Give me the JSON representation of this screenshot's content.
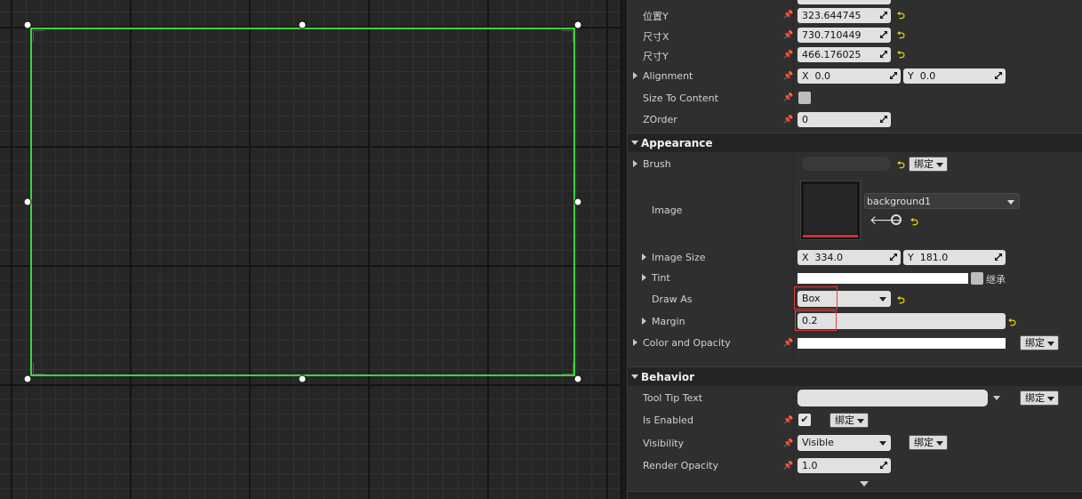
{
  "transform": {
    "pos_y_label": "位置Y",
    "pos_y_value": "323.644745",
    "size_x_label": "尺寸X",
    "size_x_value": "730.710449",
    "size_y_label": "尺寸Y",
    "size_y_value": "466.176025",
    "alignment_label": "Alignment",
    "alignment_x_prefix": "X",
    "alignment_x": "0.0",
    "alignment_y_prefix": "Y",
    "alignment_y": "0.0",
    "size_to_content_label": "Size To Content",
    "zorder_label": "ZOrder",
    "zorder_value": "0"
  },
  "appearance": {
    "header": "Appearance",
    "brush_label": "Brush",
    "bind_label": "绑定",
    "image_label": "Image",
    "image_asset": "background1",
    "image_size_label": "Image Size",
    "image_size_x_prefix": "X",
    "image_size_x": "334.0",
    "image_size_y_prefix": "Y",
    "image_size_y": "181.0",
    "tint_label": "Tint",
    "tint_inherit": "继承",
    "draw_as_label": "Draw As",
    "draw_as_value": "Box",
    "margin_label": "Margin",
    "margin_value": "0.2",
    "color_opacity_label": "Color and Opacity"
  },
  "behavior": {
    "header": "Behavior",
    "tooltip_label": "Tool Tip Text",
    "is_enabled_label": "Is Enabled",
    "is_enabled_checked": true,
    "visibility_label": "Visibility",
    "visibility_value": "Visible",
    "render_opacity_label": "Render Opacity",
    "render_opacity_value": "1.0"
  },
  "colors": {
    "selection_outline": "#3bd53b",
    "highlight_box": "#e03b3b",
    "reset_arrow": "#e8d300"
  }
}
